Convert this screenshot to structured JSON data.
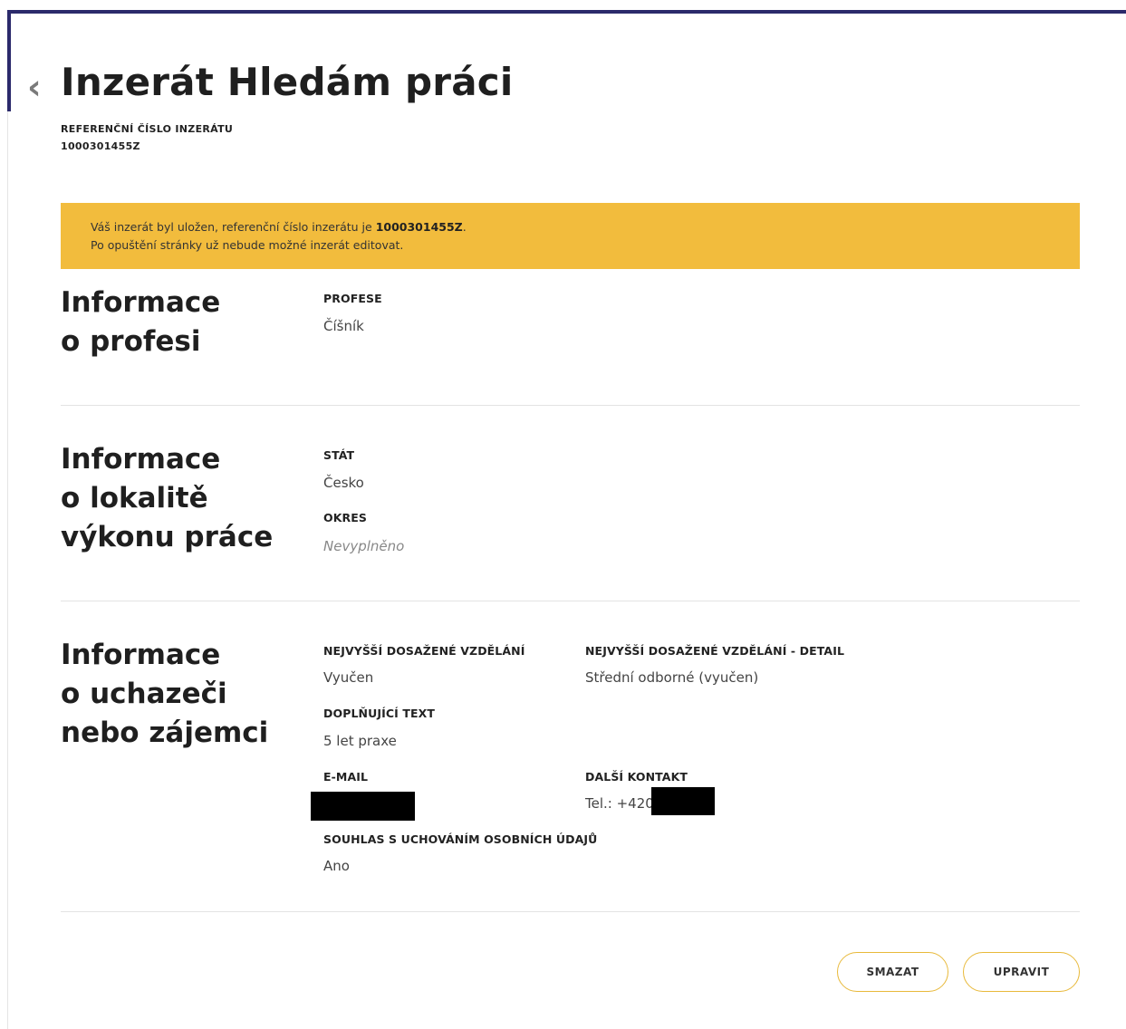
{
  "header": {
    "title": "Inzerát Hledám práci",
    "ref_label": "REFERENČNÍ ČÍSLO INZERÁTU",
    "ref_value": "1000301455Z"
  },
  "alert": {
    "line1_prefix": "Váš inzerát byl uložen, referenční číslo inzerátu je ",
    "line1_ref": "1000301455Z",
    "line1_suffix": ".",
    "line2": "Po opuštění stránky už nebude možné inzerát editovat.",
    "color": "#f2bc3d"
  },
  "profession": {
    "title_line1": "Informace",
    "title_line2": "o profesi",
    "profese_label": "PROFESE",
    "profese_value": "Číšník"
  },
  "location": {
    "title_line1": "Informace",
    "title_line2": "o lokalitě",
    "title_line3": "výkonu práce",
    "stat_label": "STÁT",
    "stat_value": "Česko",
    "okres_label": "OKRES",
    "okres_value": "Nevyplněno"
  },
  "applicant": {
    "title_line1": "Informace",
    "title_line2": "o uchazeči",
    "title_line3": "nebo zájemci",
    "education_label": "NEJVYŠŠÍ DOSAŽENÉ VZDĚLÁNÍ",
    "education_value": "Vyučen",
    "education_detail_label": "NEJVYŠŠÍ DOSAŽENÉ VZDĚLÁNÍ - DETAIL",
    "education_detail_value": "Střední odborné (vyučen)",
    "extra_text_label": "DOPLŇUJÍCÍ TEXT",
    "extra_text_value": "5 let praxe",
    "email_label": "E-MAIL",
    "contact_label": "DALŠÍ KONTAKT",
    "contact_value": "Tel.: +420",
    "consent_label": "SOUHLAS S UCHOVÁNÍM OSOBNÍCH ÚDAJŮ",
    "consent_value": "Ano"
  },
  "actions": {
    "delete_label": "SMAZAT",
    "edit_label": "UPRAVIT",
    "button_border_color": "#e8b93a"
  },
  "icons": {
    "back": "chevron-left-icon"
  },
  "colors": {
    "accent": "#2b2a6b"
  }
}
